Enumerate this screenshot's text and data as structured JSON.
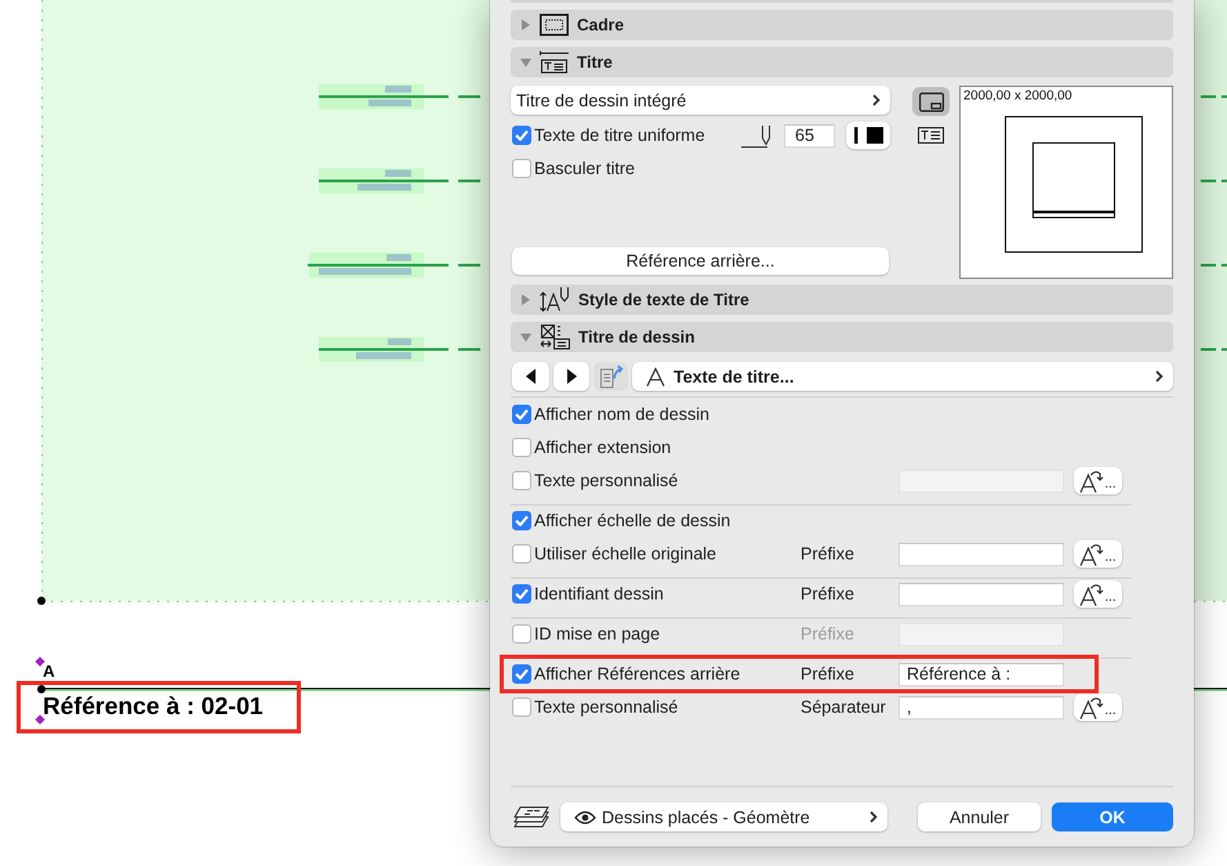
{
  "canvas": {
    "marker_letter": "A",
    "title_label": "Référence à : 02-01",
    "highlighted": true
  },
  "dialog": {
    "sections": [
      {
        "kind": "frame",
        "title": "Cadre",
        "expanded": false
      },
      {
        "kind": "title",
        "title": "Titre",
        "expanded": true,
        "panel": {
          "type_dropdown": "Titre de dessin intégré",
          "uniform_text": {
            "label": "Texte de titre uniforme",
            "checked": true,
            "pen": "65"
          },
          "flip_title": {
            "label": "Basculer titre",
            "checked": false
          },
          "back_reference_button": "Référence arrière...",
          "view_toggles": [
            {
              "selected": true
            },
            {
              "selected": false
            }
          ],
          "preview_size": "2000,00 x 2000,00"
        }
      },
      {
        "kind": "text_style",
        "title": "Style de texte de Titre",
        "expanded": false
      },
      {
        "kind": "drawing_title",
        "title": "Titre de dessin",
        "expanded": true,
        "panel": {
          "style_dropdown": "Texte de titre...",
          "groups": [
            {
              "rows": [
                {
                  "label": "Afficher nom de dessin",
                  "checked": true,
                  "highlighted": false
                },
                {
                  "label": "Afficher extension",
                  "checked": false,
                  "highlighted": false
                },
                {
                  "label": "Texte personnalisé",
                  "checked": false,
                  "highlighted": false,
                  "field": {
                    "disabled": true
                  },
                  "style_button": "..."
                }
              ]
            },
            {
              "rows": [
                {
                  "label": "Afficher échelle de dessin",
                  "checked": true,
                  "highlighted": false
                },
                {
                  "label": "Utiliser échelle originale",
                  "checked": false,
                  "highlighted": false,
                  "prefix": {
                    "text": "Préfixe",
                    "disabled": false
                  },
                  "field": {
                    "disabled": false
                  },
                  "style_button": "..."
                }
              ]
            },
            {
              "rows": [
                {
                  "label": "Identifiant dessin",
                  "checked": true,
                  "highlighted": false,
                  "prefix": {
                    "text": "Préfixe",
                    "disabled": false
                  },
                  "field": {
                    "disabled": false
                  },
                  "style_button": "..."
                }
              ]
            },
            {
              "rows": [
                {
                  "label": "ID mise en page",
                  "checked": false,
                  "highlighted": false,
                  "prefix": {
                    "text": "Préfixe",
                    "disabled": true
                  },
                  "field": {
                    "disabled": true
                  }
                }
              ]
            },
            {
              "rows": [
                {
                  "label": "Afficher Références arrière",
                  "checked": true,
                  "highlighted": true,
                  "prefix": {
                    "text": "Préfixe",
                    "disabled": false
                  },
                  "field": {
                    "value": "Référence à :",
                    "disabled": false
                  }
                },
                {
                  "label": "Texte personnalisé",
                  "checked": false,
                  "highlighted": false,
                  "prefix": {
                    "text": "Séparateur",
                    "disabled": false
                  },
                  "field": {
                    "value": ",",
                    "disabled": false
                  },
                  "style_button": "..."
                }
              ]
            }
          ]
        }
      }
    ],
    "footer": {
      "layer_set": "Dessins placés - Géomètre",
      "cancel": "Annuler",
      "ok": "OK"
    }
  }
}
